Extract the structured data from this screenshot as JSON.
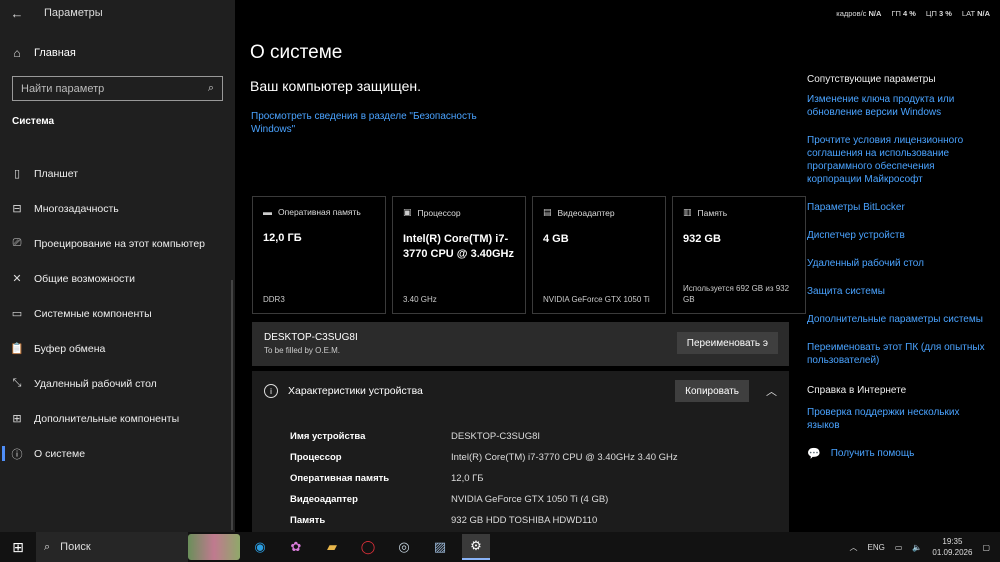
{
  "sidebar": {
    "window_title": "Параметры",
    "home_label": "Главная",
    "search_placeholder": "Найти параметр",
    "section_title": "Система",
    "items": [
      {
        "label": "Планшет",
        "icon": "tablet-icon",
        "glyph": "▯"
      },
      {
        "label": "Многозадачность",
        "icon": "multitasking-icon",
        "glyph": "⊟"
      },
      {
        "label": "Проецирование на этот компьютер",
        "icon": "projecting-icon",
        "glyph": "⎚"
      },
      {
        "label": "Общие возможности",
        "icon": "shared-experiences-icon",
        "glyph": "✕"
      },
      {
        "label": "Системные компоненты",
        "icon": "system-components-icon",
        "glyph": "▭"
      },
      {
        "label": "Буфер обмена",
        "icon": "clipboard-icon",
        "glyph": "📋"
      },
      {
        "label": "Удаленный рабочий стол",
        "icon": "remote-desktop-icon",
        "glyph": "⤡"
      },
      {
        "label": "Дополнительные компоненты",
        "icon": "optional-components-icon",
        "glyph": "⊞"
      },
      {
        "label": "О системе",
        "icon": "about-icon",
        "glyph": "ⓘ"
      }
    ]
  },
  "topbar": {
    "fps_label": "кадров/с",
    "fps_value": "N/A",
    "gpu_label": "ГП",
    "gpu_value": "4 %",
    "cpu_label": "ЦП",
    "cpu_value": "3 %",
    "lat_label": "LAT",
    "lat_value": "N/A"
  },
  "main": {
    "title": "О системе",
    "protected_text": "Ваш компьютер защищен.",
    "security_link": "Просмотреть сведения в разделе \"Безопасность Windows\"",
    "cards": [
      {
        "title": "Оперативная память",
        "icon": "ram-icon",
        "glyph": "▬",
        "value": "12,0 ГБ",
        "sub": "DDR3"
      },
      {
        "title": "Процессор",
        "icon": "cpu-icon",
        "glyph": "▣",
        "value": "Intel(R) Core(TM) i7-3770 CPU @ 3.40GHz",
        "sub": "3.40 GHz"
      },
      {
        "title": "Видеоадаптер",
        "icon": "gpu-icon",
        "glyph": "▤",
        "value": "4 GB",
        "sub": "NVIDIA GeForce GTX 1050 Ti"
      },
      {
        "title": "Память",
        "icon": "storage-icon",
        "glyph": "▥",
        "value": "932 GB",
        "sub": "Используется 692 GB из 932 GB"
      }
    ],
    "device_name": "DESKTOP-C3SUG8I",
    "oem_text": "To be filled by O.E.M.",
    "rename_button": "Переименовать э",
    "specs_title": "Характеристики устройства",
    "copy_button": "Копировать",
    "specs": [
      {
        "key": "Имя устройства",
        "value": "DESKTOP-C3SUG8I"
      },
      {
        "key": "Процессор",
        "value": "Intel(R) Core(TM) i7-3770 CPU @ 3.40GHz   3.40 GHz"
      },
      {
        "key": "Оперативная память",
        "value": "12,0 ГБ"
      },
      {
        "key": "Видеоадаптер",
        "value": "NVIDIA GeForce GTX 1050 Ti (4 GB)"
      },
      {
        "key": "Память",
        "value": "932 GB HDD TOSHIBA HDWD110"
      }
    ]
  },
  "related": {
    "title": "Сопутствующие параметры",
    "links": [
      "Изменение ключа продукта или обновление версии Windows",
      "Прочтите условия лицензионного соглашения на использование программного обеспечения корпорации Майкрософт",
      "Параметры BitLocker",
      "Диспетчер устройств",
      "Удаленный рабочий стол",
      "Защита системы",
      "Дополнительные параметры системы",
      "Переименовать этот ПК (для опытных пользователей)"
    ],
    "help_title": "Справка в Интернете",
    "help_links": [
      "Проверка поддержки нескольких языков"
    ],
    "get_help": "Получить помощь"
  },
  "taskbar": {
    "search_label": "Поиск",
    "apps": [
      {
        "name": "edge-icon",
        "glyph": "◉",
        "color": "#2b9de0"
      },
      {
        "name": "copilot-icon",
        "glyph": "✿",
        "color": "#d77bd8"
      },
      {
        "name": "file-explorer-icon",
        "glyph": "▰",
        "color": "#e8b64a"
      },
      {
        "name": "opera-icon",
        "glyph": "◯",
        "color": "#e0303a"
      },
      {
        "name": "steam-icon",
        "glyph": "◎",
        "color": "#c7d5e0"
      },
      {
        "name": "photos-icon",
        "glyph": "▨",
        "color": "#9bb8d8"
      },
      {
        "name": "settings-icon",
        "glyph": "⚙",
        "color": "#ffffff"
      }
    ],
    "language": "ENG",
    "time": "19:35",
    "date": "01.09.2026"
  }
}
